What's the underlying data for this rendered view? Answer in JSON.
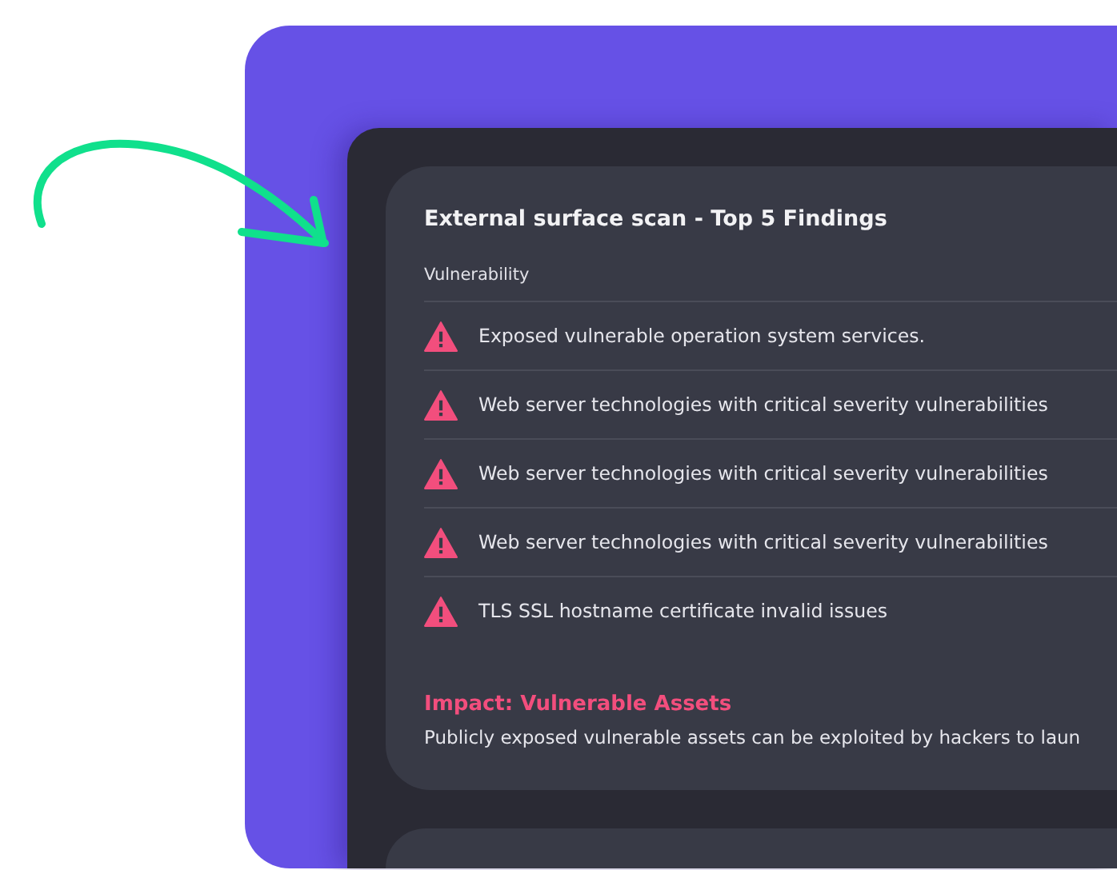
{
  "card": {
    "title": "External surface scan - Top 5 Findings",
    "column_header": "Vulnerability",
    "findings": [
      {
        "text": "Exposed vulnerable operation system services."
      },
      {
        "text": "Web server technologies with critical severity vulnerabilities"
      },
      {
        "text": "Web server technologies with critical severity vulnerabilities"
      },
      {
        "text": "Web server technologies with critical severity vulnerabilities"
      },
      {
        "text": "TLS SSL hostname certificate invalid issues"
      }
    ],
    "impact": {
      "title": "Impact: Vulnerable Assets",
      "text": "Publicly exposed vulnerable assets can be exploited by hackers to laun"
    }
  }
}
